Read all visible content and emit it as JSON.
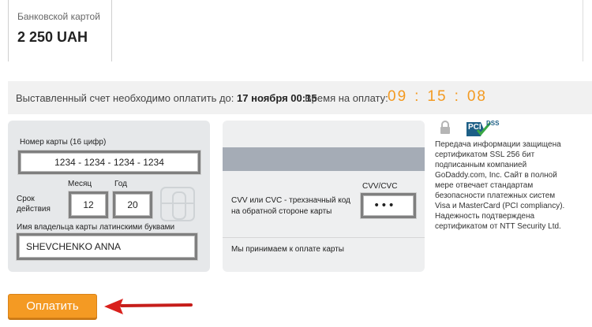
{
  "payment_tab": {
    "label": "Банковской картой",
    "amount": "2 250 UAH"
  },
  "invoice": {
    "text": "Выставленный счет необходимо оплатить до:",
    "deadline": "17 ноября 00:15",
    "time_label": "Время на оплату:",
    "timer_hours": "09",
    "timer_minutes": "15",
    "timer_seconds": "08",
    "timer_separator": ":",
    "timer_color": "#f39a21"
  },
  "card_front": {
    "card_number_label": "Номер карты (16 цифр)",
    "card_number_value": "1234 - 1234 - 1234 - 1234",
    "expiry_label_line1": "Срок",
    "expiry_label_line2": "действия",
    "month_label": "Месяц",
    "month_value": "12",
    "year_label": "Год",
    "year_value": "20",
    "holder_label": "Имя владельца карты латинскими буквами",
    "holder_value": "SHEVCHENKO ANNA"
  },
  "card_back": {
    "cvv_hint_line1": "CVV или CVC - трехзначный код",
    "cvv_hint_line2": "на обратной стороне карты",
    "cvv_label": "CVV/CVC",
    "cvv_value": "•••",
    "accepted_text": "Мы принимаем к оплате карты"
  },
  "security": {
    "badge_text": "DSS",
    "badge_prefix": "PCI",
    "description": "Передача информации защищена сертификатом SSL 256 бит подписанным компанией GoDaddy.com, Inc. Сайт в полной мере отвечает стандартам безопасности платежных систем Visa и MasterCard (PCI compliancy). Надежность подтверждена сертификатом от NTT Security Ltd."
  },
  "actions": {
    "pay_label": "Оплатить"
  },
  "icons": {
    "lock": "lock-icon",
    "pci_badge": "pci-dss-badge-icon",
    "arrow": "red-arrow-icon",
    "chip": "card-chip-icon"
  },
  "colors": {
    "accent": "#f49a23",
    "arrow": "#d9201c"
  }
}
